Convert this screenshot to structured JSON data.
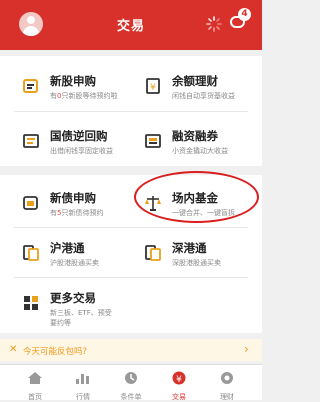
{
  "header": {
    "title": "交易",
    "msg_badge": "4"
  },
  "grid1": [
    {
      "title": "新股申购",
      "sub_pre": "有",
      "sub_num": "0",
      "sub_post": "只新股等待预约啦"
    },
    {
      "title": "余额理财",
      "sub": "闲钱自动享货基收益"
    },
    {
      "title": "国债逆回购",
      "sub": "出借闲钱享固定收益"
    },
    {
      "title": "融资融券",
      "sub": "小资金撬动大收益"
    }
  ],
  "grid2": [
    {
      "title": "新债申购",
      "sub_pre": "有",
      "sub_num": "5",
      "sub_post": "只新债待预约"
    },
    {
      "title": "场内基金",
      "sub": "一键合并、一键盲拆"
    },
    {
      "title": "沪港通",
      "sub": "沪股港股通买卖"
    },
    {
      "title": "深港通",
      "sub": "深股港股通买卖"
    },
    {
      "title": "更多交易",
      "sub": "新三板、ETF、预受要约等"
    }
  ],
  "promo": {
    "text": "今天可能反包吗?"
  },
  "tabs": [
    "首页",
    "行情",
    "条件单",
    "交易",
    "理财"
  ],
  "colors": {
    "brand": "#d8312c",
    "highlight": "#d91f1f",
    "promo": "#f29a1b"
  }
}
